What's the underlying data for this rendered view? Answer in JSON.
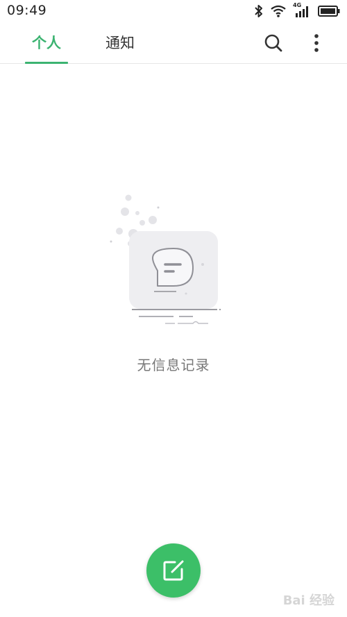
{
  "status_bar": {
    "time": "09:49",
    "network_label": "4G",
    "icons": [
      "bluetooth-icon",
      "wifi-icon",
      "signal-icon",
      "battery-icon"
    ]
  },
  "tabs": [
    {
      "label": "个人",
      "active": true
    },
    {
      "label": "通知",
      "active": false
    }
  ],
  "toolbar": {
    "icons": [
      "search-icon",
      "more-vertical-icon"
    ]
  },
  "empty_state": {
    "message": "无信息记录",
    "icon": "message-bubble-icon"
  },
  "fab": {
    "icon": "edit-icon"
  },
  "watermark": {
    "text": "Bai 经验"
  },
  "colors": {
    "accent": "#3cb371",
    "fab": "#3cbf68",
    "text_muted": "#777777"
  }
}
